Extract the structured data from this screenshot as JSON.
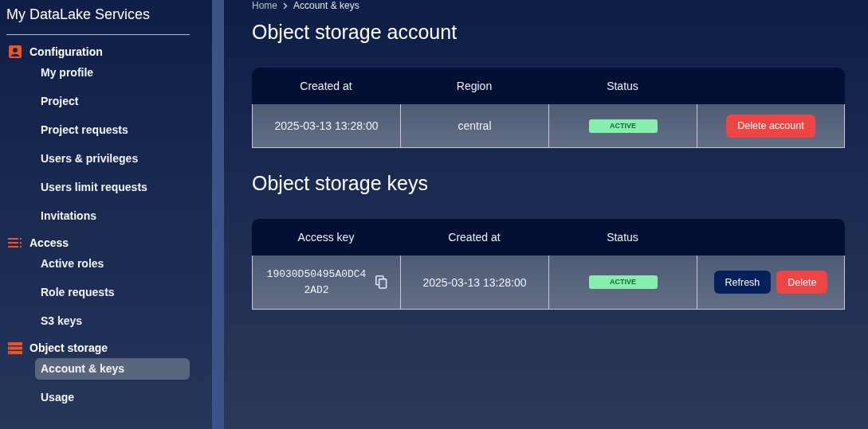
{
  "sidebar": {
    "title": "My DataLake Services",
    "groups": [
      {
        "label": "Configuration",
        "kind": "person",
        "items": [
          {
            "label": "My profile",
            "selected": false
          },
          {
            "label": "Project",
            "selected": false
          },
          {
            "label": "Project requests",
            "selected": false
          },
          {
            "label": "Users & privileges",
            "selected": false
          },
          {
            "label": "Users limit requests",
            "selected": false
          },
          {
            "label": "Invitations",
            "selected": false
          }
        ]
      },
      {
        "label": "Access",
        "kind": "list",
        "items": [
          {
            "label": "Active roles",
            "selected": false
          },
          {
            "label": "Role requests",
            "selected": false
          },
          {
            "label": "S3 keys",
            "selected": false
          }
        ]
      },
      {
        "label": "Object storage",
        "kind": "storage",
        "items": [
          {
            "label": "Account & keys",
            "selected": true
          },
          {
            "label": "Usage",
            "selected": false
          }
        ]
      }
    ]
  },
  "breadcrumb": [
    "Home",
    "Account & keys"
  ],
  "sections": [
    {
      "title": "Object storage account",
      "columns": [
        "Created at",
        "Region",
        "Status",
        ""
      ],
      "rows": [
        {
          "cells": [
            {
              "kind": "text",
              "text": "2025-03-13 13:28:00"
            },
            {
              "kind": "text",
              "text": "central"
            },
            {
              "kind": "status",
              "text": "ACTIVE"
            },
            {
              "kind": "actions",
              "buttons": [
                {
                  "label": "Delete account",
                  "kind": "danger"
                }
              ]
            }
          ]
        }
      ]
    },
    {
      "title": "Object storage keys",
      "columns": [
        "Access key",
        "Created at",
        "Status",
        ""
      ],
      "rows": [
        {
          "cells": [
            {
              "kind": "key",
              "text": "19030D50495A0DC42AD2"
            },
            {
              "kind": "text",
              "text": "2025-03-13 13:28:00"
            },
            {
              "kind": "status",
              "text": "ACTIVE"
            },
            {
              "kind": "actions",
              "buttons": [
                {
                  "label": "Refresh",
                  "kind": "primary"
                },
                {
                  "label": "Delete",
                  "kind": "danger"
                }
              ]
            }
          ]
        }
      ]
    }
  ]
}
